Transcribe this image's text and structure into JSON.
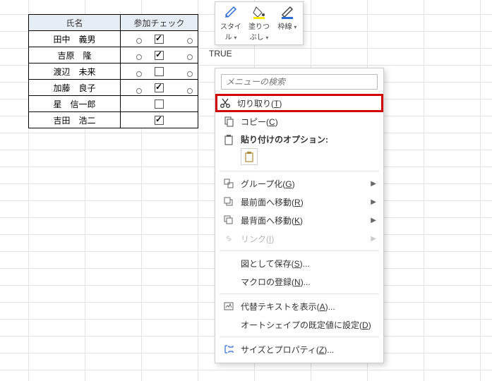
{
  "table": {
    "headers": {
      "name": "氏名",
      "check": "参加チェック"
    },
    "rows": [
      {
        "name": "田中　義男",
        "checked": true
      },
      {
        "name": "吉原　隆",
        "checked": true
      },
      {
        "name": "渡辺　未来",
        "checked": false
      },
      {
        "name": "加藤　良子",
        "checked": true
      },
      {
        "name": "星　信一郎",
        "checked": false
      },
      {
        "name": "吉田　浩二",
        "checked": true
      }
    ]
  },
  "cell_value": "TRUE",
  "ribbon": {
    "style": "スタイ\nル",
    "fill": "塗りつ\nぶし",
    "border": "枠線"
  },
  "menu": {
    "search_placeholder": "メニューの検索",
    "cut": "切り取り",
    "cut_key": "T",
    "copy": "コピー",
    "copy_key": "C",
    "paste_options": "貼り付けのオプション:",
    "group": "グループ化",
    "group_key": "G",
    "bring_front": "最前面へ移動",
    "bring_front_key": "R",
    "send_back": "最背面へ移動",
    "send_back_key": "K",
    "link": "リンク",
    "link_key": "I",
    "save_as_picture": "図として保存",
    "save_as_picture_key": "S",
    "assign_macro": "マクロの登録",
    "assign_macro_key": "N",
    "alt_text": "代替テキストを表示",
    "alt_text_key": "A",
    "set_autoshape_default": "オートシェイプの既定値に設定",
    "set_autoshape_default_key": "D",
    "size_props": "サイズとプロパティ",
    "size_props_key": "Z"
  }
}
